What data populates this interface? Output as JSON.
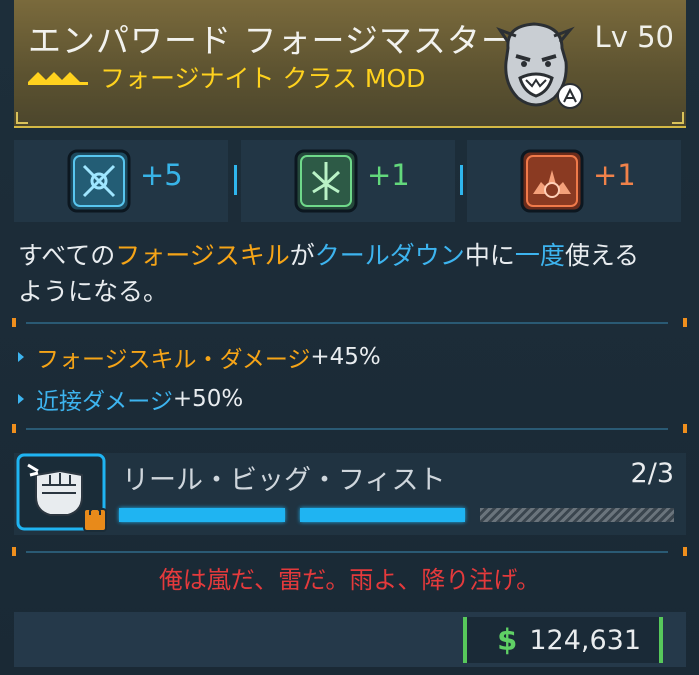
{
  "header": {
    "title": "エンパワード フォージマスター",
    "class_name": "フォージナイト クラス MOD",
    "level": "Lv 50",
    "colors": {
      "accent": "#ffd21e",
      "header_bg": "#6b5f37"
    }
  },
  "skills": [
    {
      "icon": "crossed-blades-icon",
      "value": "+5",
      "color": "#38b4e8"
    },
    {
      "icon": "leaf-burst-icon",
      "value": "+1",
      "color": "#63d87c"
    },
    {
      "icon": "flame-gear-icon",
      "value": "+1",
      "color": "#f0824a"
    }
  ],
  "description": {
    "p1": "すべての",
    "h1": "フォージスキル",
    "p2": "が",
    "h2": "クールダウン",
    "p3": "中に",
    "h3": "一度",
    "p4": "使える",
    "p5": "ようになる。"
  },
  "stats": [
    {
      "label": "フォージスキル・ダメージ",
      "value": "+45%"
    },
    {
      "label": "近接ダメージ",
      "value": "+50%"
    }
  ],
  "ability": {
    "name": "リール・ビッグ・フィスト",
    "count": "2/3",
    "filled": 2,
    "total": 3,
    "icon": "fist-icon",
    "lock_icon": "lock-icon"
  },
  "quote": "俺は嵐だ、雷だ。雨よ、降り注げ。",
  "price": {
    "currency_symbol": "$",
    "amount": "124,631",
    "color": "#5fd065"
  }
}
